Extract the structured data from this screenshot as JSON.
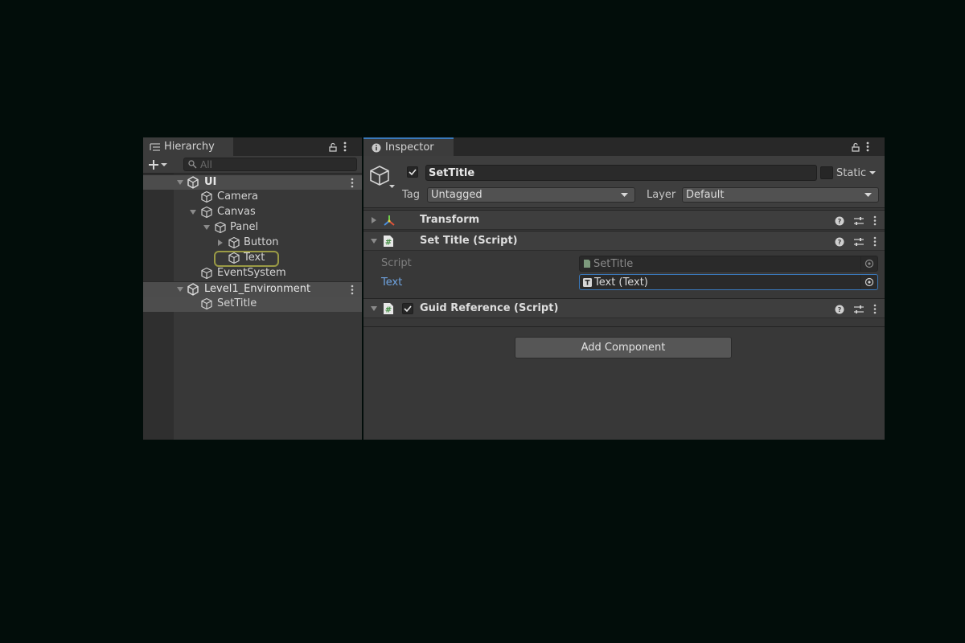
{
  "colors": {
    "accent": "#3a79bb",
    "link_label": "#6fa3e0",
    "highlight_ring": "#9a9a45"
  },
  "hierarchy": {
    "tab_label": "Hierarchy",
    "search_placeholder": "All",
    "rows": [
      {
        "label": "UI",
        "type": "scene"
      },
      {
        "label": "Camera",
        "type": "object"
      },
      {
        "label": "Canvas",
        "type": "object",
        "expanded": true
      },
      {
        "label": "Panel",
        "type": "object",
        "expanded": true
      },
      {
        "label": "Button",
        "type": "object",
        "expanded": false
      },
      {
        "label": "Text",
        "type": "object",
        "highlighted": true
      },
      {
        "label": "EventSystem",
        "type": "object"
      },
      {
        "label": "Level1_Environment",
        "type": "scene"
      },
      {
        "label": "SetTitle",
        "type": "object",
        "selected": true
      }
    ]
  },
  "inspector": {
    "tab_label": "Inspector",
    "object_name": "SetTitle",
    "active": true,
    "static_label": "Static",
    "tag_label": "Tag",
    "tag_value": "Untagged",
    "layer_label": "Layer",
    "layer_value": "Default",
    "components": [
      {
        "title": "Transform",
        "expanded": false
      },
      {
        "title": "Set Title (Script)",
        "expanded": true,
        "fields": [
          {
            "label": "Script",
            "value": "SetTitle"
          },
          {
            "label": "Text",
            "value": "Text (Text)"
          }
        ]
      },
      {
        "title": "Guid Reference (Script)",
        "expanded": true,
        "enabled": true
      }
    ],
    "add_component_label": "Add Component"
  }
}
